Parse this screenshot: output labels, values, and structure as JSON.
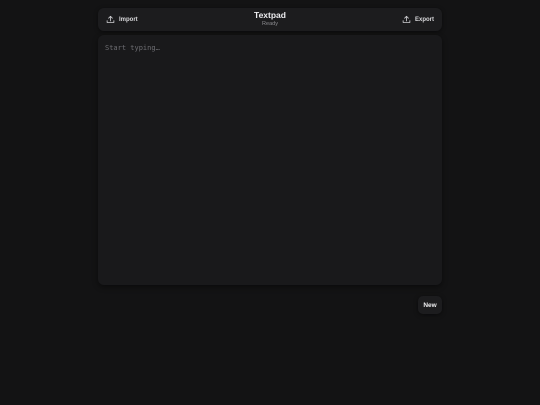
{
  "header": {
    "title": "Textpad",
    "status": "Ready",
    "import_label": "Import",
    "import_icon": "upload-icon",
    "export_label": "Export",
    "export_icon": "upload-icon"
  },
  "editor": {
    "placeholder": "Start typing…",
    "value": ""
  },
  "actions": {
    "new_label": "New"
  },
  "colors": {
    "background": "#131314",
    "panel": "#1c1c1e",
    "editor": "#19191b",
    "text": "#e8e8ea",
    "muted": "#8c8c90"
  }
}
